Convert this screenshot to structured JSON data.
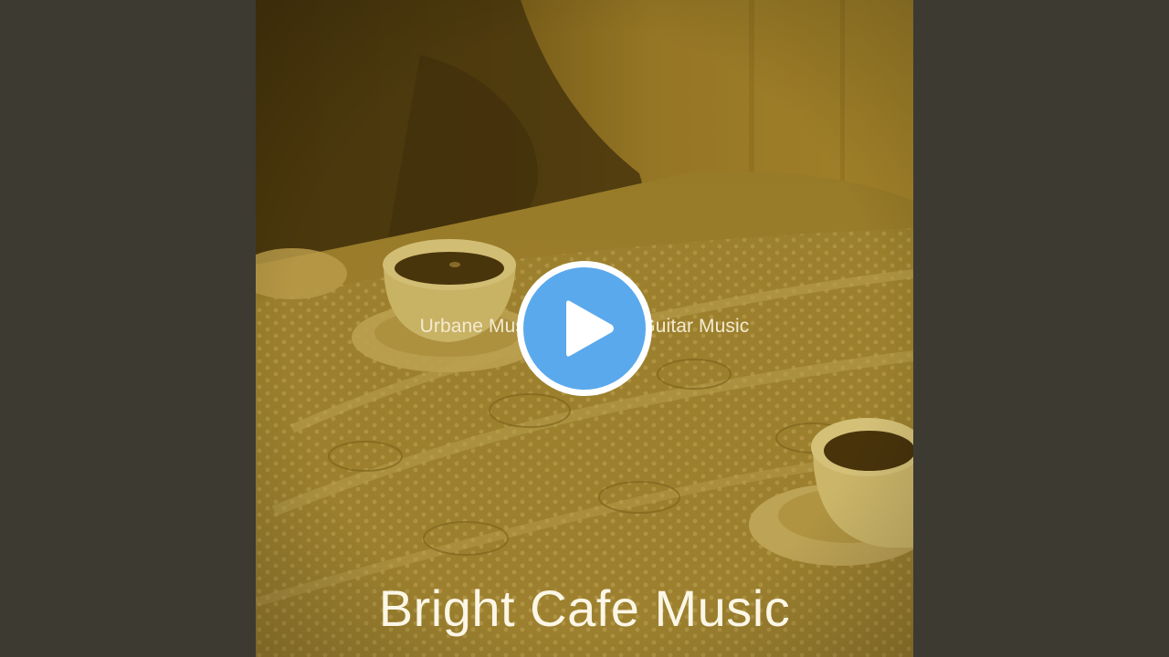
{
  "video": {
    "track_title": "Urbane Music for Cafes - Guitar Music",
    "artist": "Bright Cafe Music",
    "play_icon": "play-icon"
  },
  "colors": {
    "background": "#3d3a32",
    "art_tint": "#8a6e22",
    "play_accent": "#5aa9ec",
    "play_ring": "#ffffff"
  }
}
